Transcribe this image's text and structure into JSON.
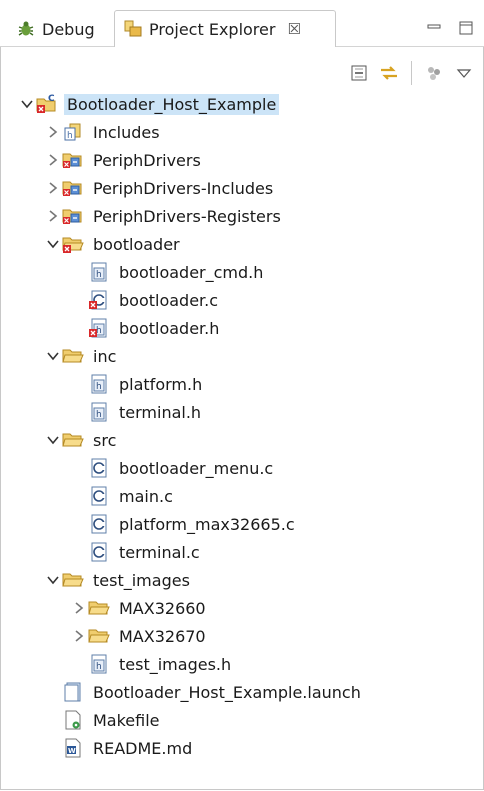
{
  "tabs": {
    "debug": {
      "label": "Debug",
      "icon": "bug-icon"
    },
    "project_explorer": {
      "label": "Project Explorer",
      "icon": "project-explorer-icon",
      "close": "☒"
    }
  },
  "toolbar": {
    "items": [
      "collapse-all-icon",
      "link-with-editor-icon",
      "focus-icon",
      "view-menu-icon"
    ]
  },
  "tree": [
    {
      "label": "Bootloader_Host_Example",
      "depth": 0,
      "twisty": "open",
      "icon": "c-project-icon",
      "selected": true
    },
    {
      "label": "Includes",
      "depth": 1,
      "twisty": "closed",
      "icon": "includes-icon"
    },
    {
      "label": "PeriphDrivers",
      "depth": 1,
      "twisty": "closed",
      "icon": "linked-folder-icon"
    },
    {
      "label": "PeriphDrivers-Includes",
      "depth": 1,
      "twisty": "closed",
      "icon": "linked-folder-icon"
    },
    {
      "label": "PeriphDrivers-Registers",
      "depth": 1,
      "twisty": "closed",
      "icon": "linked-folder-icon"
    },
    {
      "label": "bootloader",
      "depth": 1,
      "twisty": "open",
      "icon": "folder-error-icon"
    },
    {
      "label": "bootloader_cmd.h",
      "depth": 2,
      "twisty": "none",
      "icon": "header-file-icon"
    },
    {
      "label": "bootloader.c",
      "depth": 2,
      "twisty": "none",
      "icon": "c-file-error-icon"
    },
    {
      "label": "bootloader.h",
      "depth": 2,
      "twisty": "none",
      "icon": "header-file-error-icon"
    },
    {
      "label": "inc",
      "depth": 1,
      "twisty": "open",
      "icon": "folder-open-icon"
    },
    {
      "label": "platform.h",
      "depth": 2,
      "twisty": "none",
      "icon": "header-file-icon"
    },
    {
      "label": "terminal.h",
      "depth": 2,
      "twisty": "none",
      "icon": "header-file-icon"
    },
    {
      "label": "src",
      "depth": 1,
      "twisty": "open",
      "icon": "folder-open-icon"
    },
    {
      "label": "bootloader_menu.c",
      "depth": 2,
      "twisty": "none",
      "icon": "c-file-icon"
    },
    {
      "label": "main.c",
      "depth": 2,
      "twisty": "none",
      "icon": "c-file-icon"
    },
    {
      "label": "platform_max32665.c",
      "depth": 2,
      "twisty": "none",
      "icon": "c-file-icon"
    },
    {
      "label": "terminal.c",
      "depth": 2,
      "twisty": "none",
      "icon": "c-file-icon"
    },
    {
      "label": "test_images",
      "depth": 1,
      "twisty": "open",
      "icon": "folder-open-icon"
    },
    {
      "label": "MAX32660",
      "depth": 2,
      "twisty": "closed",
      "icon": "folder-open-icon"
    },
    {
      "label": "MAX32670",
      "depth": 2,
      "twisty": "closed",
      "icon": "folder-open-icon"
    },
    {
      "label": "test_images.h",
      "depth": 2,
      "twisty": "none",
      "icon": "header-file-icon"
    },
    {
      "label": "Bootloader_Host_Example.launch",
      "depth": 1,
      "twisty": "none",
      "icon": "launch-file-icon"
    },
    {
      "label": "Makefile",
      "depth": 1,
      "twisty": "none",
      "icon": "makefile-icon"
    },
    {
      "label": "README.md",
      "depth": 1,
      "twisty": "none",
      "icon": "word-doc-icon"
    }
  ]
}
